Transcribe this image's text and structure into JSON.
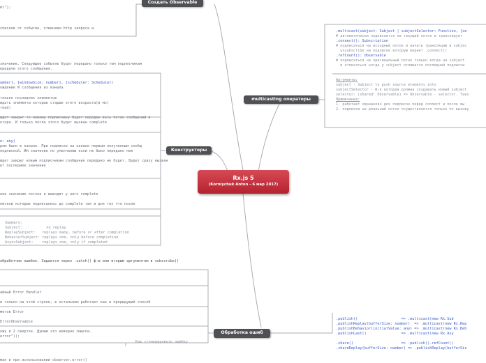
{
  "center": {
    "title": "Rx.js 5",
    "subtitle": "(Korniychuk Anton - 6 мар 2017)"
  },
  "branches": {
    "create": "Создать Observable",
    "constructors": "Конструкторы",
    "multicasting": "multicasting операторы",
    "errors": "Обработка ошиб"
  },
  "error_sub": "Как сгенерировать ошибку",
  "left": {
    "l1": "ml\");",
    "l2": "списков от событие, отменяем http запроса и",
    "l3": "значение. Следующее событие будет передано только тем подписчикам",
    "l4": "ередачи этого сообщения.",
    "l5": "umber], [windowSize: number], [scheduler: Schedule])",
    "l6": "ождение N сообщения из канала",
    "l7": "только последних элементов",
    "l8": "ждать элементы которые старше этого возраста(в мс)",
    "l9": "read)",
    "l10": "ждет закрыт то новому подписчику будет передан весь поток сообщений в",
    "l11": "ктора. И только после этого будет вызван complete",
    "l12": "e: any)",
    "l13": "ром было в канале. При подписке на канале первым полученным сообщ",
    "l14": "подпиской. Им значение по умолчанию если не было передано ник",
    "l15": "ждет закрыт новым подписчикам сообщения передано не будет. Будет сразу вызван",
    "l16": "ет последнее значение",
    "l17": "нее значение потока и выводит у него complete",
    "l18": "писков которые подписались до complete так и для тех что после",
    "summary": [
      "Summary:",
      "Subject:           no replay",
      "ReplaySubject:   replays many, before or after completion",
      "BehaviorSubject: replays one, only before completion",
      "AsyncSubject:    replays one, only if completed"
    ],
    "l19": "обработчик ошибок. Задается через .catch() ф-ю или вторым аргументом в subscribe()",
    "l20": "айный Error Handler",
    "l21": "и только на этой строке, в остальном работает как и предыдущий способ",
    "l22": "метов Error",
    "l23": "ErrorObservable",
    "l24": "ожу в 2 свертке. Думаю это неверно смысла.",
    "l25": "error\"));",
    "l26": "ман и при использовании observer.error()"
  },
  "right_top": {
    "r1": ".multicast(subject: Subject | subjectSelector: Function, [se",
    "r2": "# автоматически подписается на текущий поток и транслирует",
    "r3": ".connect(): Subscription",
    "r4": "# подписаться на исходный поток и начать трансляцию в subjec",
    "r5": "  unsubscribe на подписке которую вернет .connect()",
    "r6": ".refCount(): Observable",
    "r7": "# подписаться на оригинальный поток только когда на subject",
    "r8": "  и отписаться когда у subject отпишется последний подписчи"
  },
  "right_mid": {
    "r9": "Аргументы:",
    "r10": "subject - Subject to push source elements into",
    "r11": "subjectSelector - Ф-я которая должна создавать новый subject",
    "r12": "selector: (shared: Observable) => Observable - selector. Тако",
    "r13": "Примечания:",
    "r14": "1. работает одинаково для подписок перед connect и после вы",
    "r15": "2. подписка на реальный поток осуществляется только по вызову"
  },
  "right_bot": {
    "b1": ".publish()                    => .multicast(new Rx.Sub",
    "b2": ".publishReplay(bufferSize: number)  => .multicast(new Rx.Rep",
    "b3": ".publishBehavior(initialValue: any) => .multicast(new Rx.Beh",
    "b4": ".publishLast()                => .multicast(new Rx.Asy",
    "b5": ".share()                      => .publish().refCount()",
    "b6": ".shareReplay(bufferSize: number) => .publishReplay(bufferSiz"
  },
  "colors": {
    "center": "#c12f3c",
    "node": "#4f5054",
    "line": "#a9adb3"
  }
}
